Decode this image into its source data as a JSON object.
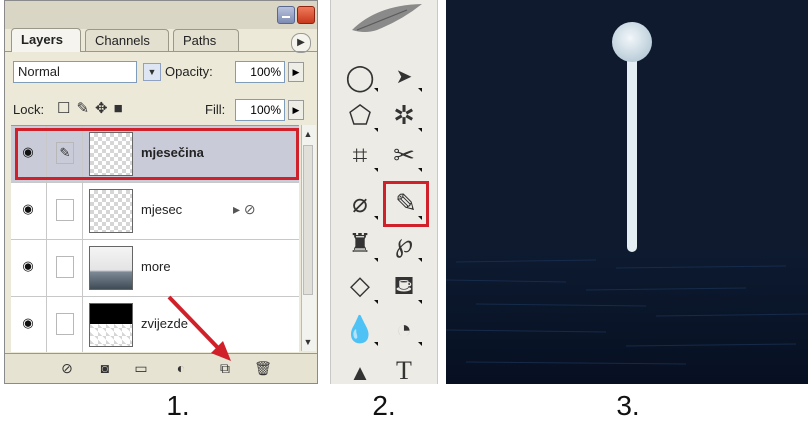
{
  "panel1": {
    "tabs": [
      "Layers",
      "Channels",
      "Paths"
    ],
    "blend_mode": "Normal",
    "opacity_label": "Opacity:",
    "opacity_value": "100%",
    "lock_label": "Lock:",
    "fill_label": "Fill:",
    "fill_value": "100%",
    "layers": [
      {
        "name": "mjesečina",
        "selected": true
      },
      {
        "name": "mjesec",
        "selected": false
      },
      {
        "name": "more",
        "selected": false
      },
      {
        "name": "zvijezde",
        "selected": false
      }
    ],
    "bottom_icons": [
      "link-layers-icon",
      "layer-style-icon",
      "mask-icon",
      "adjustment-icon",
      "new-set-icon",
      "new-layer-icon",
      "trash-icon"
    ]
  },
  "panel2": {
    "tools": [
      "marquee",
      "move",
      "lasso",
      "magic-wand",
      "crop",
      "slice",
      "healing-brush",
      "brush",
      "clone-stamp",
      "history-brush",
      "eraser",
      "paint-bucket",
      "blur",
      "dodge",
      "path-select",
      "type"
    ],
    "type_tool_glyph": "T"
  },
  "colors": {
    "highlight": "#d0202a",
    "night_sky": "#0f1a2e",
    "moon": "#dfe9ef"
  },
  "captions": [
    "1.",
    "2.",
    "3."
  ]
}
